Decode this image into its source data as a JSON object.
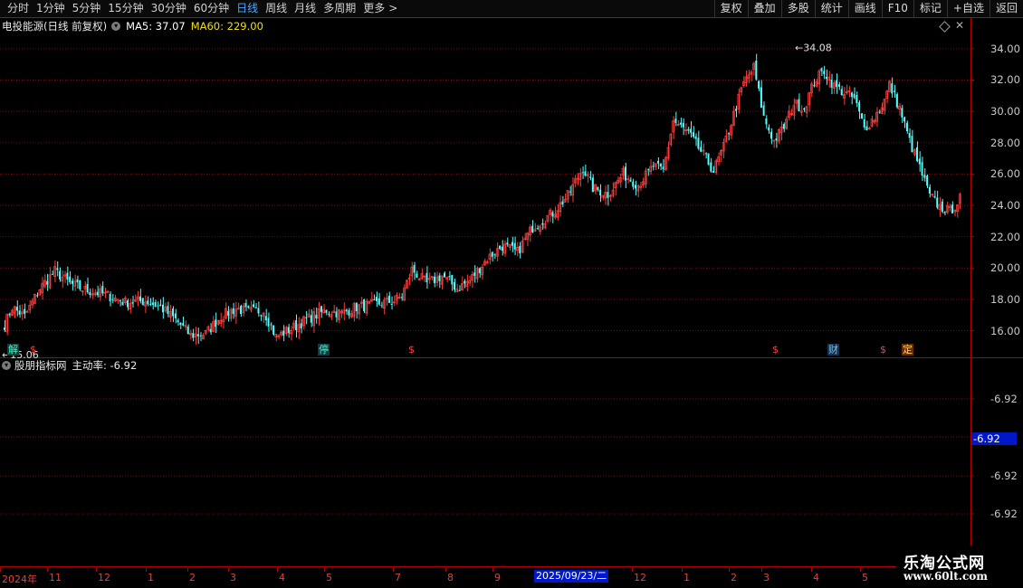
{
  "toolbar": {
    "period_tabs": [
      "分时",
      "1分钟",
      "5分钟",
      "15分钟",
      "30分钟",
      "60分钟",
      "日线",
      "周线",
      "月线",
      "多周期",
      "更多"
    ],
    "active_tab": "日线",
    "more_arrow": ">",
    "actions": [
      "复权",
      "叠加",
      "多股",
      "统计",
      "画线",
      "F10",
      "标记",
      "+自选",
      "返回"
    ]
  },
  "chart_header": {
    "stock_name": "电投能源(日线 前复权)",
    "ma5": "MA5: 37.07",
    "ma60": "MA60: 229.00"
  },
  "colors": {
    "up": "#ff3c3c",
    "down": "#54ffff",
    "ma60": "#f0e000",
    "grid": "#8b0000",
    "axis": "#b00000"
  },
  "chart_data": {
    "type": "candlestick",
    "y_ticks": [
      "34.00",
      "32.00",
      "30.00",
      "28.00",
      "26.00",
      "24.00",
      "22.00",
      "20.00",
      "18.00",
      "16.00"
    ],
    "ylim": [
      14.3,
      34.8
    ],
    "high_label": "34.08",
    "low_label": "15.06",
    "anchors": [
      [
        0,
        16.4
      ],
      [
        3,
        17.5
      ],
      [
        8,
        16.9
      ],
      [
        14,
        18.7
      ],
      [
        20,
        19.8
      ],
      [
        26,
        19.0
      ],
      [
        32,
        18.6
      ],
      [
        40,
        18.3
      ],
      [
        48,
        17.8
      ],
      [
        56,
        17.9
      ],
      [
        62,
        17.5
      ],
      [
        68,
        16.7
      ],
      [
        74,
        15.7
      ],
      [
        80,
        15.8
      ],
      [
        86,
        16.9
      ],
      [
        92,
        17.4
      ],
      [
        97,
        17.2
      ],
      [
        103,
        17.3
      ],
      [
        108,
        15.6
      ],
      [
        115,
        16.2
      ],
      [
        120,
        16.7
      ],
      [
        128,
        17.3
      ],
      [
        134,
        17.1
      ],
      [
        140,
        17.5
      ],
      [
        148,
        17.7
      ],
      [
        155,
        17.9
      ],
      [
        158,
        18.2
      ],
      [
        162,
        19.9
      ],
      [
        168,
        19.0
      ],
      [
        174,
        19.5
      ],
      [
        180,
        18.7
      ],
      [
        185,
        19.2
      ],
      [
        192,
        20.6
      ],
      [
        198,
        21.4
      ],
      [
        204,
        21.0
      ],
      [
        210,
        22.6
      ],
      [
        218,
        23.5
      ],
      [
        224,
        24.6
      ],
      [
        230,
        26.4
      ],
      [
        234,
        25.1
      ],
      [
        240,
        24.7
      ],
      [
        246,
        26.0
      ],
      [
        252,
        25.3
      ],
      [
        258,
        26.5
      ],
      [
        262,
        26.2
      ],
      [
        266,
        29.4
      ],
      [
        272,
        28.6
      ],
      [
        278,
        27.2
      ],
      [
        282,
        26.2
      ],
      [
        286,
        27.7
      ],
      [
        290,
        29.8
      ],
      [
        294,
        31.8
      ],
      [
        298,
        32.8
      ],
      [
        302,
        29.6
      ],
      [
        306,
        28.1
      ],
      [
        310,
        29.0
      ],
      [
        314,
        30.5
      ],
      [
        318,
        30.2
      ],
      [
        322,
        31.9
      ],
      [
        326,
        32.6
      ],
      [
        330,
        31.6
      ],
      [
        334,
        31.2
      ],
      [
        338,
        30.8
      ],
      [
        342,
        28.9
      ],
      [
        346,
        29.6
      ],
      [
        350,
        30.7
      ],
      [
        352,
        31.7
      ],
      [
        356,
        30.2
      ],
      [
        360,
        28.1
      ],
      [
        364,
        26.4
      ],
      [
        368,
        24.6
      ],
      [
        372,
        23.9
      ],
      [
        376,
        23.6
      ],
      [
        380,
        24.4
      ]
    ],
    "signals": [
      {
        "text": "解",
        "color": "#48f0c0",
        "bg": "#1a3a3a"
      },
      {
        "text": "$",
        "color": "#ff3c3c",
        "bg": "none"
      },
      {
        "text": "停",
        "color": "#48f0c0",
        "bg": "#183848"
      },
      {
        "text": "$",
        "color": "#ff3c3c",
        "bg": "none"
      },
      {
        "text": "$",
        "color": "#ff3c3c",
        "bg": "none"
      },
      {
        "text": "财",
        "color": "#60c0ff",
        "bg": "#183048"
      },
      {
        "text": "$",
        "color": "#ff3c3c",
        "bg": "none"
      },
      {
        "text": "定",
        "color": "#ffd060",
        "bg": "#6a2a10"
      }
    ]
  },
  "indicator": {
    "name": "股朋指标网",
    "value_label": "主动率: -6.92",
    "y_ticks": [
      "-6.92",
      "-6.92",
      "-6.92",
      "-6.92"
    ],
    "current_value": "-6.92"
  },
  "date_axis": {
    "labels": [
      "2024年",
      "11",
      "12",
      "1",
      "2",
      "3",
      "4",
      "5",
      "7",
      "8",
      "9",
      "12",
      "1",
      "2",
      "3",
      "4",
      "5"
    ],
    "cursor_date": "2025/09/23/二"
  },
  "watermark": {
    "title": "乐淘公式网",
    "url": "www.60lt.com"
  }
}
